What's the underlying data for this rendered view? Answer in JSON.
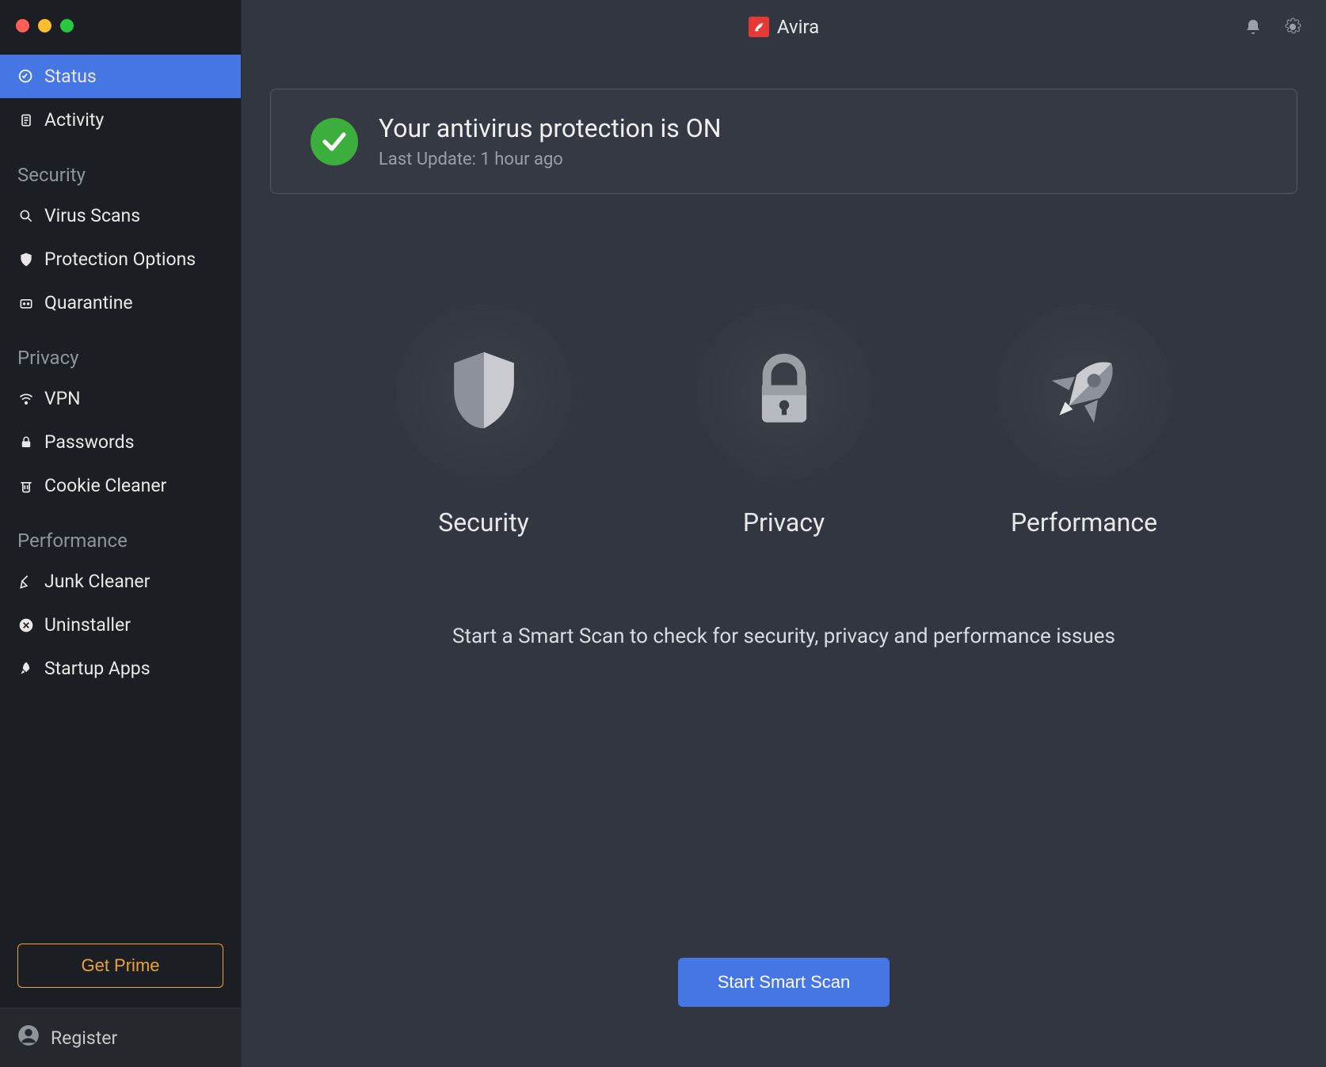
{
  "brand": {
    "name": "Avira"
  },
  "sidebar": {
    "top": [
      {
        "label": "Status",
        "icon": "activity-monitor"
      },
      {
        "label": "Activity",
        "icon": "clipboard"
      }
    ],
    "sections": [
      {
        "title": "Security",
        "items": [
          {
            "label": "Virus Scans",
            "icon": "search"
          },
          {
            "label": "Protection Options",
            "icon": "shield"
          },
          {
            "label": "Quarantine",
            "icon": "box"
          }
        ]
      },
      {
        "title": "Privacy",
        "items": [
          {
            "label": "VPN",
            "icon": "wifi"
          },
          {
            "label": "Passwords",
            "icon": "lock"
          },
          {
            "label": "Cookie Cleaner",
            "icon": "trash"
          }
        ]
      },
      {
        "title": "Performance",
        "items": [
          {
            "label": "Junk Cleaner",
            "icon": "broom"
          },
          {
            "label": "Uninstaller",
            "icon": "x-circle"
          },
          {
            "label": "Startup Apps",
            "icon": "rocket"
          }
        ]
      }
    ],
    "prime_label": "Get Prime",
    "register_label": "Register"
  },
  "status_banner": {
    "title": "Your antivirus protection is ON",
    "subtitle": "Last Update: 1 hour ago"
  },
  "features": [
    {
      "label": "Security"
    },
    {
      "label": "Privacy"
    },
    {
      "label": "Performance"
    }
  ],
  "scan_prompt": "Start a Smart Scan to check for security, privacy and performance issues",
  "scan_button_label": "Start Smart Scan"
}
